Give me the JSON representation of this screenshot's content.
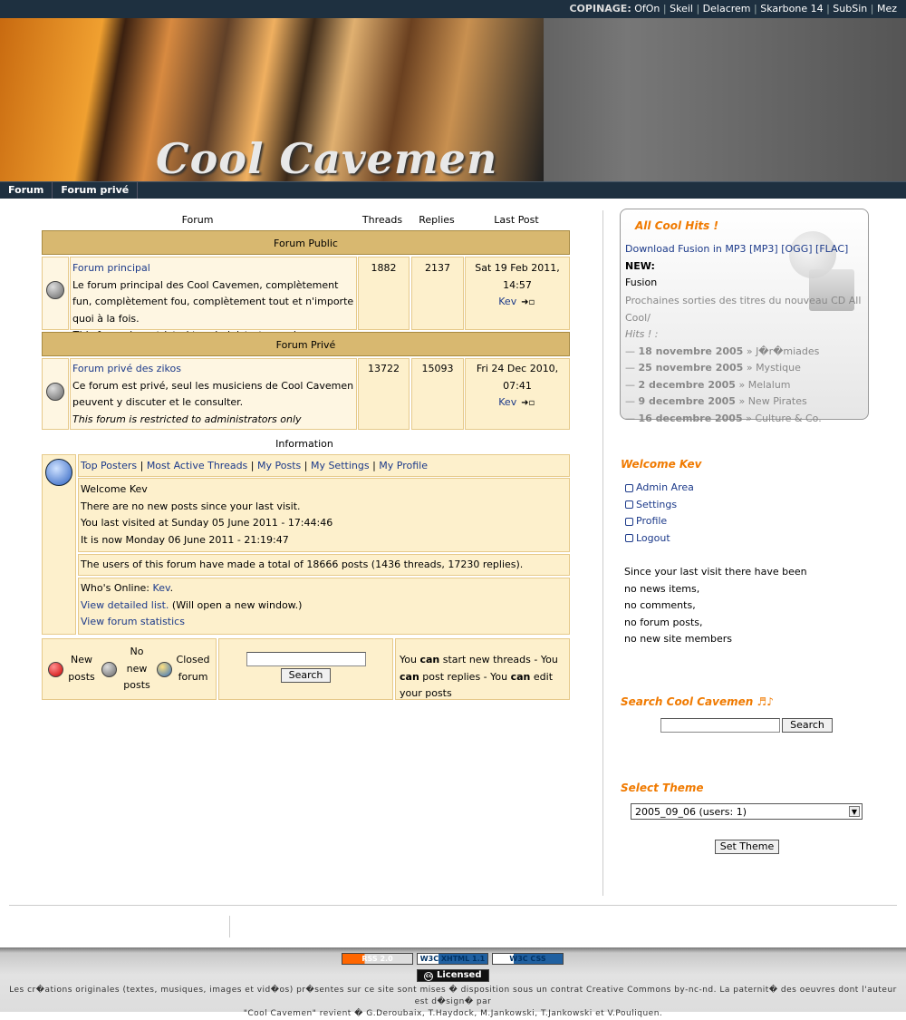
{
  "topbar": {
    "label": "COPINAGE:",
    "links": [
      "OfOn",
      "Skeil",
      "Delacrem",
      "Skarbone 14",
      "SubSin",
      "Mez"
    ]
  },
  "banner": {
    "logo": "Cool Cavemen"
  },
  "nav": [
    "Forum",
    "Forum privé"
  ],
  "forum": {
    "headers": {
      "forum": "Forum",
      "threads": "Threads",
      "replies": "Replies",
      "last_post": "Last Post"
    },
    "categories": [
      {
        "title": "Forum Public",
        "forum_name": "Forum principal",
        "description": "Le forum principal des Cool Cavemen, complètement fun, complètement fou, complètement tout et n'importe quoi à la fois.",
        "restricted": "This forum is restricted to administrators only",
        "threads": "1882",
        "replies": "2137",
        "last_date": "Sat 19 Feb 2011, 14:57",
        "last_user": "Kev"
      },
      {
        "title": "Forum Privé",
        "forum_name": "Forum privé des zikos",
        "description": "Ce forum est privé, seul les musiciens de Cool Cavemen peuvent y discuter et le consulter.",
        "restricted": "This forum is restricted to administrators only",
        "threads": "13722",
        "replies": "15093",
        "last_date": "Fri 24 Dec 2010, 07:41",
        "last_user": "Kev"
      }
    ],
    "info_title": "Information",
    "info_links": [
      "Top Posters",
      "Most Active Threads",
      "My Posts",
      "My Settings",
      "My Profile"
    ],
    "welcome": "Welcome Kev",
    "no_new": "There are no new posts since your last visit.",
    "last_visit": "You last visited at Sunday 05 June 2011 - 17:44:46",
    "now": "It is now Monday 06 June 2011 - 21:19:47",
    "totals": "The users of this forum have made a total of 18666 posts (1436 threads, 17230 replies).",
    "whos_online_label": "Who's Online:",
    "whos_online_user": "Kev",
    "detailed_list": "View detailed list.",
    "detailed_note": "(Will open a new window.)",
    "stats_link": "View forum statistics",
    "legend": {
      "new": "New posts",
      "no_new": "No new posts",
      "closed": "Closed forum"
    },
    "search_button": "Search",
    "perms": {
      "p1": "You",
      "can": "can",
      "p2": "start new threads - You",
      "p3": "post replies - You",
      "p4": "edit your posts"
    }
  },
  "sidebar": {
    "hits_title": "All Cool Hits !",
    "download_text": "Download Fusion in MP3",
    "formats": [
      "[MP3]",
      "[OGG]",
      "[FLAC]"
    ],
    "new_label": "NEW:",
    "new_title": "Fusion",
    "upcoming": "Prochaines sorties des titres du nouveau CD All Cool",
    "upcoming_italic": "Hits ! :",
    "releases": [
      {
        "date": "18 novembre 2005",
        "title": "J�r�miades"
      },
      {
        "date": "25 novembre 2005",
        "title": "Mystique"
      },
      {
        "date": "2 decembre 2005",
        "title": "Melalum"
      },
      {
        "date": "9 decembre 2005",
        "title": "New Pirates"
      },
      {
        "date": "16 decembre 2005",
        "title": "Culture & Co."
      }
    ],
    "welcome_title": "Welcome Kev",
    "user_links": [
      "Admin Area",
      "Settings",
      "Profile",
      "Logout"
    ],
    "since_lines": [
      "Since your last visit there have been",
      "no news items,",
      "no comments,",
      "no forum posts,",
      "no new site members"
    ],
    "search_title": "Search Cool Cavemen ♬♪",
    "search_button": "Search",
    "theme_title": "Select Theme",
    "theme_value": "2005_09_06 (users: 1)",
    "theme_button": "Set Theme"
  },
  "footer": {
    "badges": [
      "RSS 2.0",
      "W3C XHTML 1.1",
      "W3C CSS"
    ],
    "license": "Licensed",
    "line1": "Les cr�ations originales (textes, musiques, images et vid�os) pr�sentes sur ce site sont mises � disposition sous un contrat Creative Commons by-nc-nd. La paternit� des oeuvres dont l'auteur est d�sign� par",
    "line2": "\"Cool Cavemen\" revient � G.Deroubaix, T.Haydock, M.Jankowski, T.Jankowski et V.Pouliquen."
  },
  "colors": {
    "orange": "#f07a00",
    "cat_bg": "#d8b870",
    "cell_bg": "#fdf0cc",
    "nav_bg": "#1e3040",
    "link": "#1c3a8a"
  }
}
